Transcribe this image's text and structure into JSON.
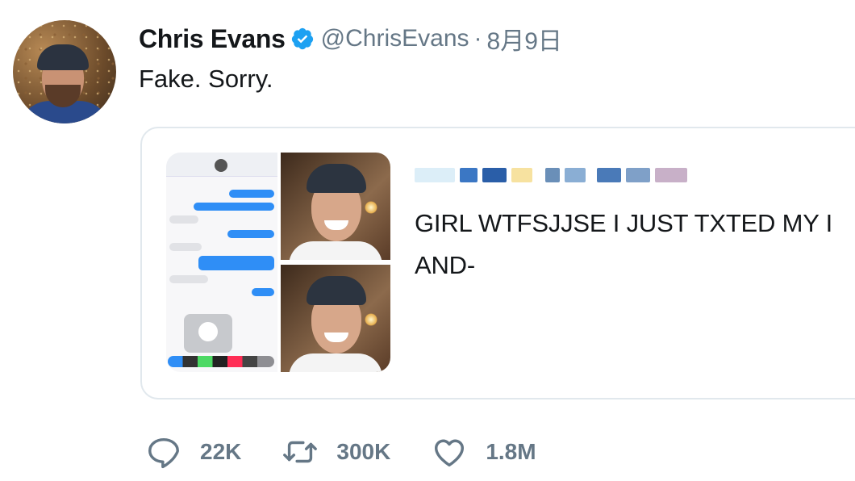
{
  "tweet": {
    "author_name": "Chris Evans",
    "handle": "@ChrisEvans",
    "separator": "·",
    "date": "8月9日",
    "text": "Fake. Sorry."
  },
  "quoted": {
    "text": "GIRL WTFSJJSE I JUST TXTED MY I\nAND-"
  },
  "actions": {
    "replies": "22K",
    "retweets": "300K",
    "likes": "1.8M"
  },
  "colors": {
    "verified": "#1da1f2",
    "muted": "#657786",
    "text": "#14171a",
    "border": "#e1e8ed"
  },
  "icons": {
    "verified": "verified-badge-icon",
    "reply": "reply-icon",
    "retweet": "retweet-icon",
    "like": "heart-icon"
  }
}
